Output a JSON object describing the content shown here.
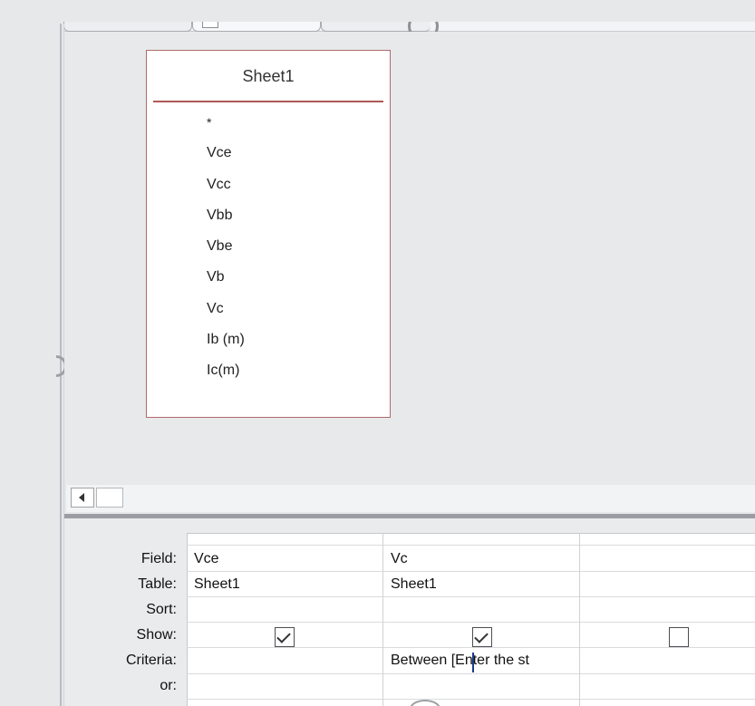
{
  "table_box": {
    "title": "Sheet1",
    "fields": [
      "*",
      "Vce",
      "Vcc",
      "Vbb",
      "Vbe",
      "Vb",
      "Vc",
      "Ib (m)",
      "Ic(m)"
    ]
  },
  "grid": {
    "row_labels": {
      "field": "Field:",
      "table": "Table:",
      "sort": "Sort:",
      "show": "Show:",
      "criteria": "Criteria:",
      "or": "or:"
    },
    "columns": [
      {
        "field": "Vce",
        "table": "Sheet1",
        "sort": "",
        "show": true,
        "criteria": "",
        "or": ""
      },
      {
        "field": "Vc",
        "table": "Sheet1",
        "sort": "",
        "show": true,
        "criteria": "Between [Enter the st",
        "or": ""
      },
      {
        "field": "",
        "table": "",
        "sort": "",
        "show": false,
        "criteria": "",
        "or": ""
      }
    ]
  }
}
